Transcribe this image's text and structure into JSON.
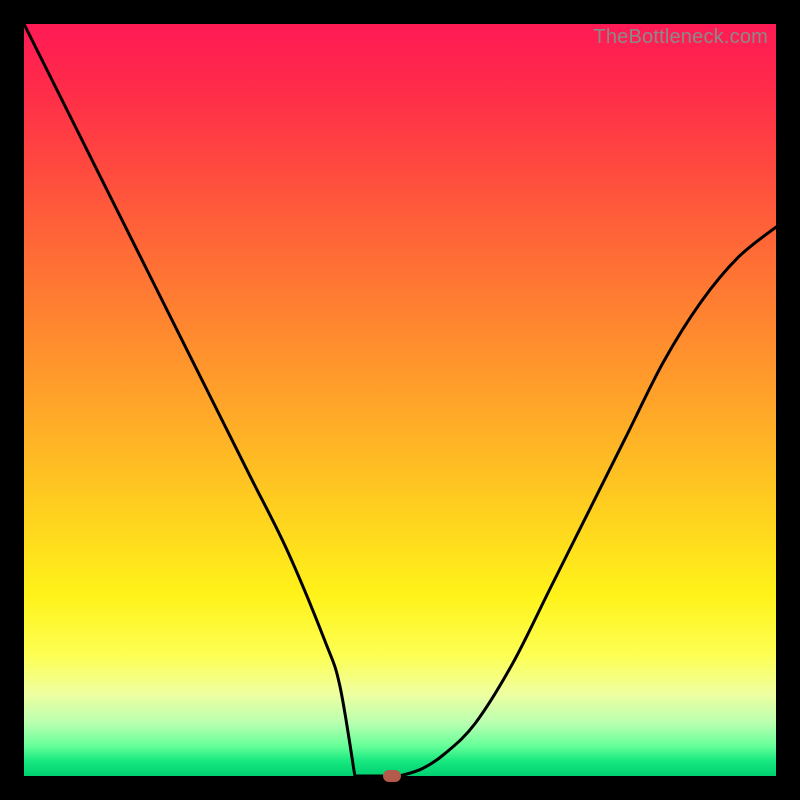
{
  "watermark": "TheBottleneck.com",
  "colors": {
    "frame": "#000000",
    "curve": "#000000",
    "marker": "#b35a4a"
  },
  "chart_data": {
    "type": "line",
    "title": "",
    "xlabel": "",
    "ylabel": "",
    "xlim": [
      0,
      100
    ],
    "ylim": [
      0,
      100
    ],
    "grid": false,
    "legend": false,
    "series": [
      {
        "name": "bottleneck-curve",
        "x": [
          0,
          5,
          10,
          15,
          20,
          25,
          30,
          35,
          40,
          42,
          44,
          46,
          47,
          49,
          50,
          53,
          56,
          60,
          65,
          70,
          75,
          80,
          85,
          90,
          95,
          100
        ],
        "values": [
          100,
          90,
          80,
          70,
          60,
          50,
          40,
          30,
          18,
          12,
          7,
          3,
          1,
          0,
          0,
          1,
          3,
          7,
          15,
          25,
          35,
          45,
          55,
          63,
          69,
          73
        ]
      }
    ],
    "marker": {
      "x": 49,
      "y": 0
    },
    "flat_bottom": {
      "x_start": 44,
      "x_end": 50,
      "y": 0
    }
  }
}
